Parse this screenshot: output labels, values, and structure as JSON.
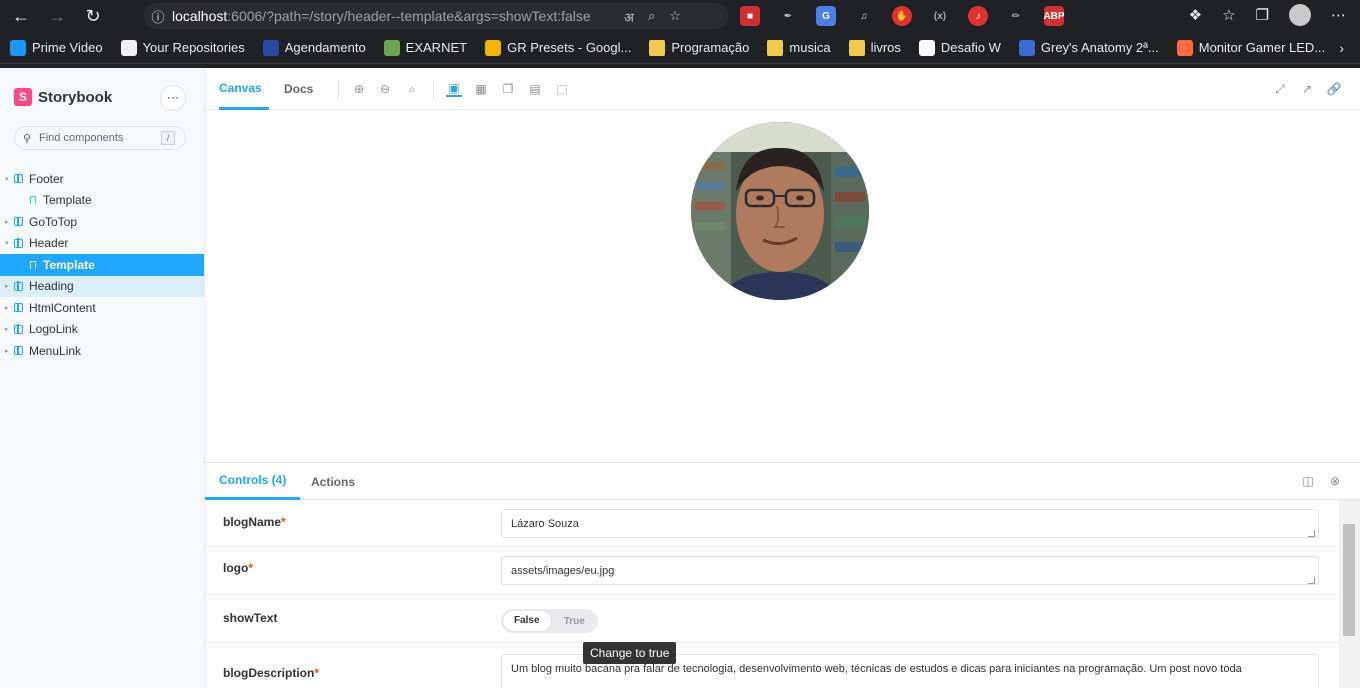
{
  "browser": {
    "url_host": "localhost",
    "url_rest": ":6006/?path=/story/header--template&args=showText:false",
    "bookmarks": [
      {
        "label": "Prime Video",
        "color": "#1a98ff"
      },
      {
        "label": "Your Repositories",
        "color": "#f0f0f0"
      },
      {
        "label": "Agendamento",
        "color": "#2a4aa0"
      },
      {
        "label": "EXARNET",
        "color": "#6aa84f"
      },
      {
        "label": "GR Presets - Googl...",
        "color": "#f4b400"
      },
      {
        "label": "Programação",
        "color": "#f2c94c",
        "folder": true
      },
      {
        "label": "musica",
        "color": "#f2c94c",
        "folder": true
      },
      {
        "label": "livros",
        "color": "#f2c94c",
        "folder": true
      },
      {
        "label": "Desafio W",
        "color": "#ffffff"
      },
      {
        "label": "Grey's Anatomy 2ª...",
        "color": "#3b6bd6"
      },
      {
        "label": "Monitor Gamer LED...",
        "color": "#ff6a3d"
      }
    ]
  },
  "sidebar": {
    "brand": "Storybook",
    "search_placeholder": "Find components",
    "search_shortcut": "/",
    "tree": [
      {
        "label": "Footer",
        "type": "component"
      },
      {
        "label": "Template",
        "type": "story"
      },
      {
        "label": "GoToTop",
        "type": "component"
      },
      {
        "label": "Header",
        "type": "component"
      },
      {
        "label": "Template",
        "type": "story",
        "selected": true
      },
      {
        "label": "Heading",
        "type": "component",
        "hovered": true
      },
      {
        "label": "HtmlContent",
        "type": "component"
      },
      {
        "label": "LogoLink",
        "type": "component"
      },
      {
        "label": "MenuLink",
        "type": "component"
      }
    ]
  },
  "toolbar": {
    "tab_canvas": "Canvas",
    "tab_docs": "Docs"
  },
  "addons": {
    "tab_controls": "Controls (4)",
    "tab_actions": "Actions",
    "controls": [
      {
        "name": "blogName",
        "required": "*",
        "value": "Lázaro Souza"
      },
      {
        "name": "logo",
        "required": "*",
        "value": "assets/images/eu.jpg"
      },
      {
        "name": "showText",
        "required": "",
        "false_label": "False",
        "true_label": "True"
      },
      {
        "name": "blogDescription",
        "required": "*",
        "value": "Um blog muito bacana pra falar de tecnologia, desenvolvimento web, técnicas de estudos e dicas para iniciantes na programação. Um post novo toda"
      }
    ],
    "tooltip": "Change to true"
  }
}
